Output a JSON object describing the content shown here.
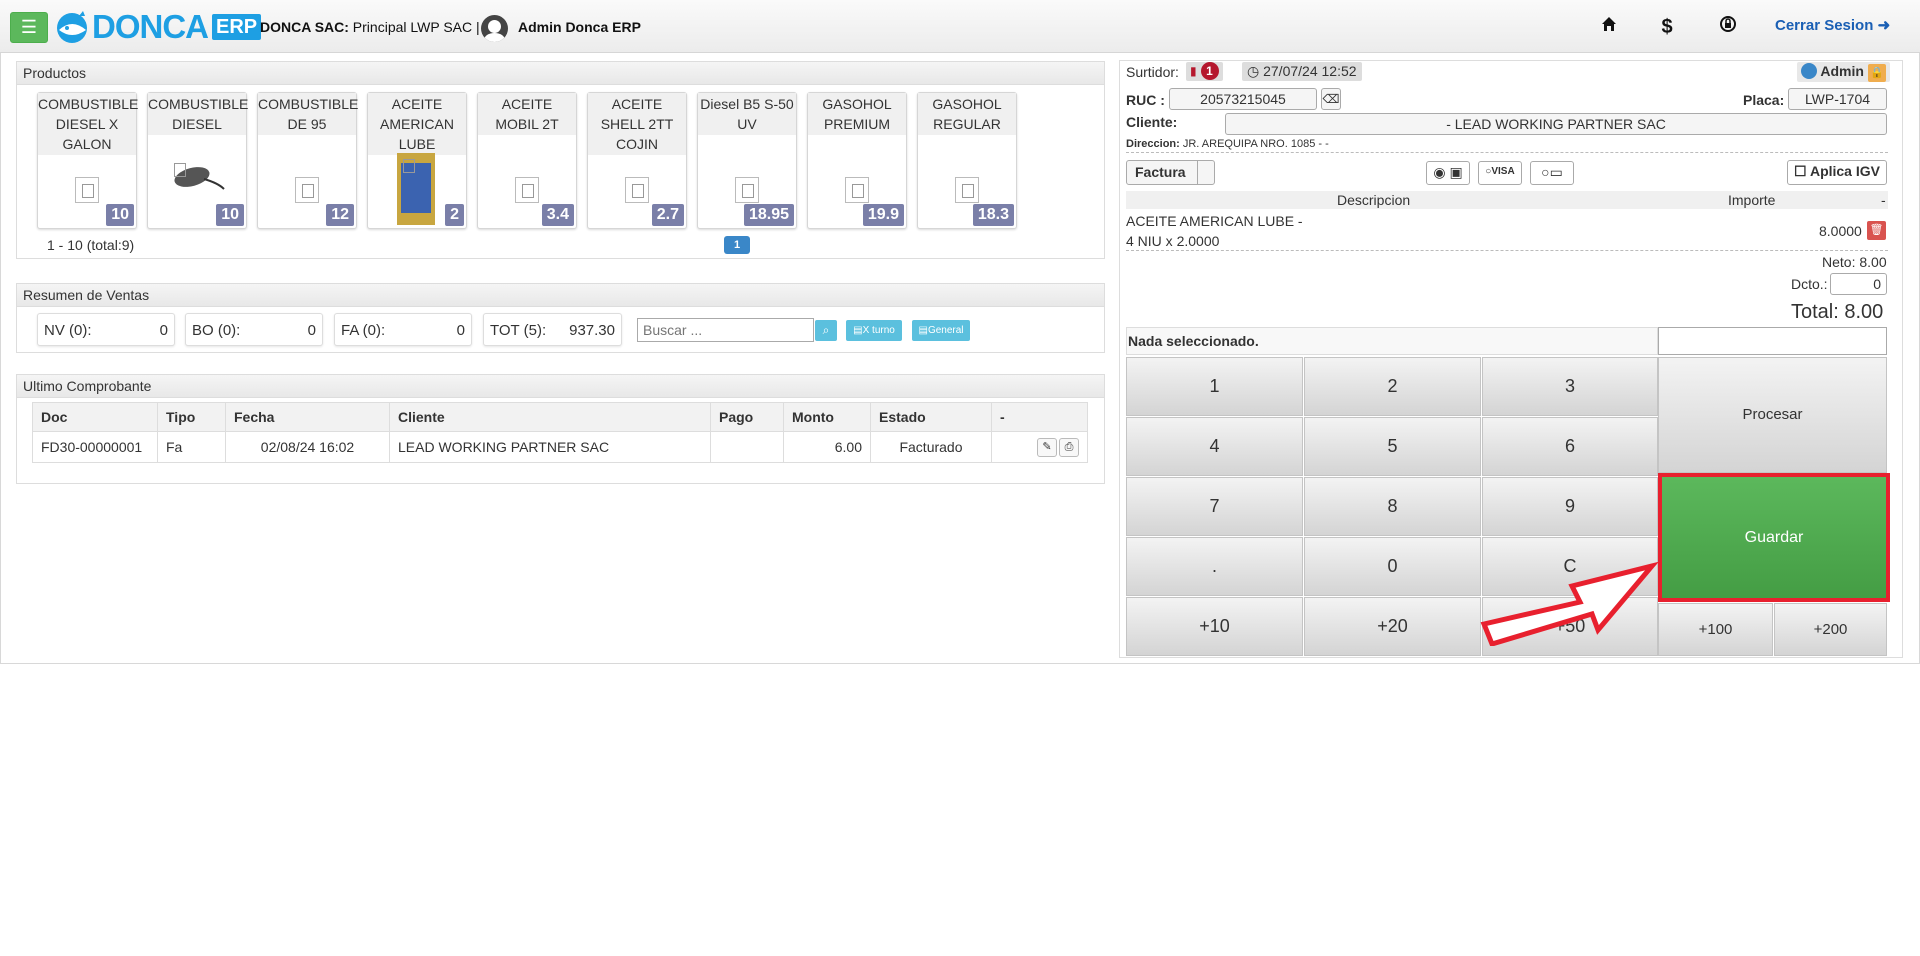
{
  "header": {
    "company_label": "DONCA SAC:",
    "company_rest": " Principal LWP SAC |",
    "user": "Admin Donca ERP",
    "logo_text": "DONCA",
    "logo_badge": "ERP",
    "logout": "Cerrar Sesion"
  },
  "products": {
    "title": "Productos",
    "items": [
      {
        "name": "COMBUSTIBLE DIESEL X GALON",
        "price": "10"
      },
      {
        "name": "COMBUSTIBLE DIESEL",
        "price": "10"
      },
      {
        "name": "COMBUSTIBLE DE 95",
        "price": "12"
      },
      {
        "name": "ACEITE AMERICAN LUBE",
        "price": "2"
      },
      {
        "name": "ACEITE MOBIL 2T",
        "price": "3.4"
      },
      {
        "name": "ACEITE SHELL 2TT COJIN",
        "price": "2.7"
      },
      {
        "name": "Diesel B5 S-50 UV",
        "price": "18.95"
      },
      {
        "name": "GASOHOL PREMIUM",
        "price": "19.9"
      },
      {
        "name": "GASOHOL REGULAR",
        "price": "18.3"
      }
    ],
    "pager_info": "1 - 10 (total:9)",
    "page": "1"
  },
  "summary": {
    "title": "Resumen de Ventas",
    "stats": [
      {
        "label": "NV (0):",
        "value": "0"
      },
      {
        "label": "BO (0):",
        "value": "0"
      },
      {
        "label": "FA (0):",
        "value": "0"
      },
      {
        "label": "TOT (5):",
        "value": "937.30"
      }
    ],
    "search_placeholder": "Buscar ...",
    "xturno": "X turno",
    "general": "General"
  },
  "last": {
    "title": "Ultimo Comprobante",
    "headers": [
      "Doc",
      "Tipo",
      "Fecha",
      "Cliente",
      "Pago",
      "Monto",
      "Estado",
      "-"
    ],
    "row": {
      "doc": "FD30-00000001",
      "tipo": "Fa",
      "fecha": "02/08/24 16:02",
      "cliente": "LEAD WORKING PARTNER SAC",
      "pago": "",
      "monto": "6.00",
      "estado": "Facturado"
    }
  },
  "sale": {
    "surtidor_label": "Surtidor:",
    "surtidor_num": "1",
    "datetime": "27/07/24 12:52",
    "admin": "Admin",
    "ruc_label": "RUC :",
    "ruc": "20573215045",
    "placa_label": "Placa:",
    "placa": "LWP-1704",
    "cliente_label": "Cliente:",
    "cliente": "- LEAD WORKING PARTNER SAC",
    "direccion_label": "Direccion:",
    "direccion": "JR. AREQUIPA NRO. 1085 - -",
    "doc_type": "Factura",
    "igv": "Aplica IGV",
    "col_desc": "Descripcion",
    "col_imp": "Importe",
    "col_dash": "-",
    "item_line1": "ACEITE AMERICAN LUBE -",
    "item_line2": "4 NIU x 2.0000",
    "item_amount": "8.0000",
    "neto": "Neto: 8.00",
    "dcto_label": "Dcto.:",
    "dcto": "0",
    "total": "Total: 8.00",
    "nada": "Nada seleccionado."
  },
  "keypad": {
    "k1": "1",
    "k2": "2",
    "k3": "3",
    "k4": "4",
    "k5": "5",
    "k6": "6",
    "k7": "7",
    "k8": "8",
    "k9": "9",
    "kdot": ".",
    "k0": "0",
    "kc": "C",
    "p10": "+10",
    "p20": "+20",
    "p50": "+50",
    "p100": "+100",
    "p200": "+200",
    "procesar": "Procesar",
    "guardar": "Guardar"
  },
  "colors": {
    "accent": "#5cb85c",
    "highlight": "#e8202e",
    "brand": "#1e9fe3"
  }
}
